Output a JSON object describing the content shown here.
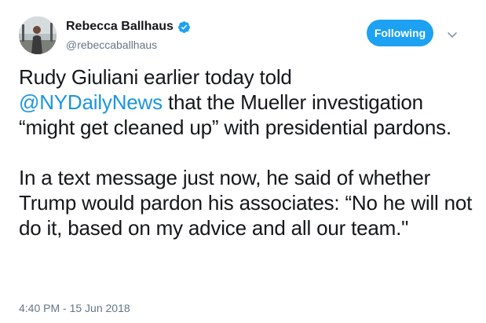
{
  "author": {
    "display_name": "Rebecca Ballhaus",
    "handle": "@rebeccaballhaus",
    "verified": true
  },
  "actions": {
    "follow_label": "Following"
  },
  "tweet": {
    "line1_before": "Rudy Giuliani earlier today told",
    "mention": "@NYDailyNews",
    "line1_after": " that the Mueller investigation “might get cleaned up” with presidential pardons.",
    "paragraph2": "In a text message just now, he said of whether Trump would pardon his associates: “No he will not do it, based on my advice and all our team.\""
  },
  "timestamp": "4:40 PM - 15 Jun 2018",
  "colors": {
    "accent": "#1da1f2",
    "link": "#1b95e0",
    "text": "#14171a",
    "secondary": "#657786"
  },
  "icons": {
    "verified": "verified-badge-icon",
    "caret": "chevron-down-icon"
  }
}
